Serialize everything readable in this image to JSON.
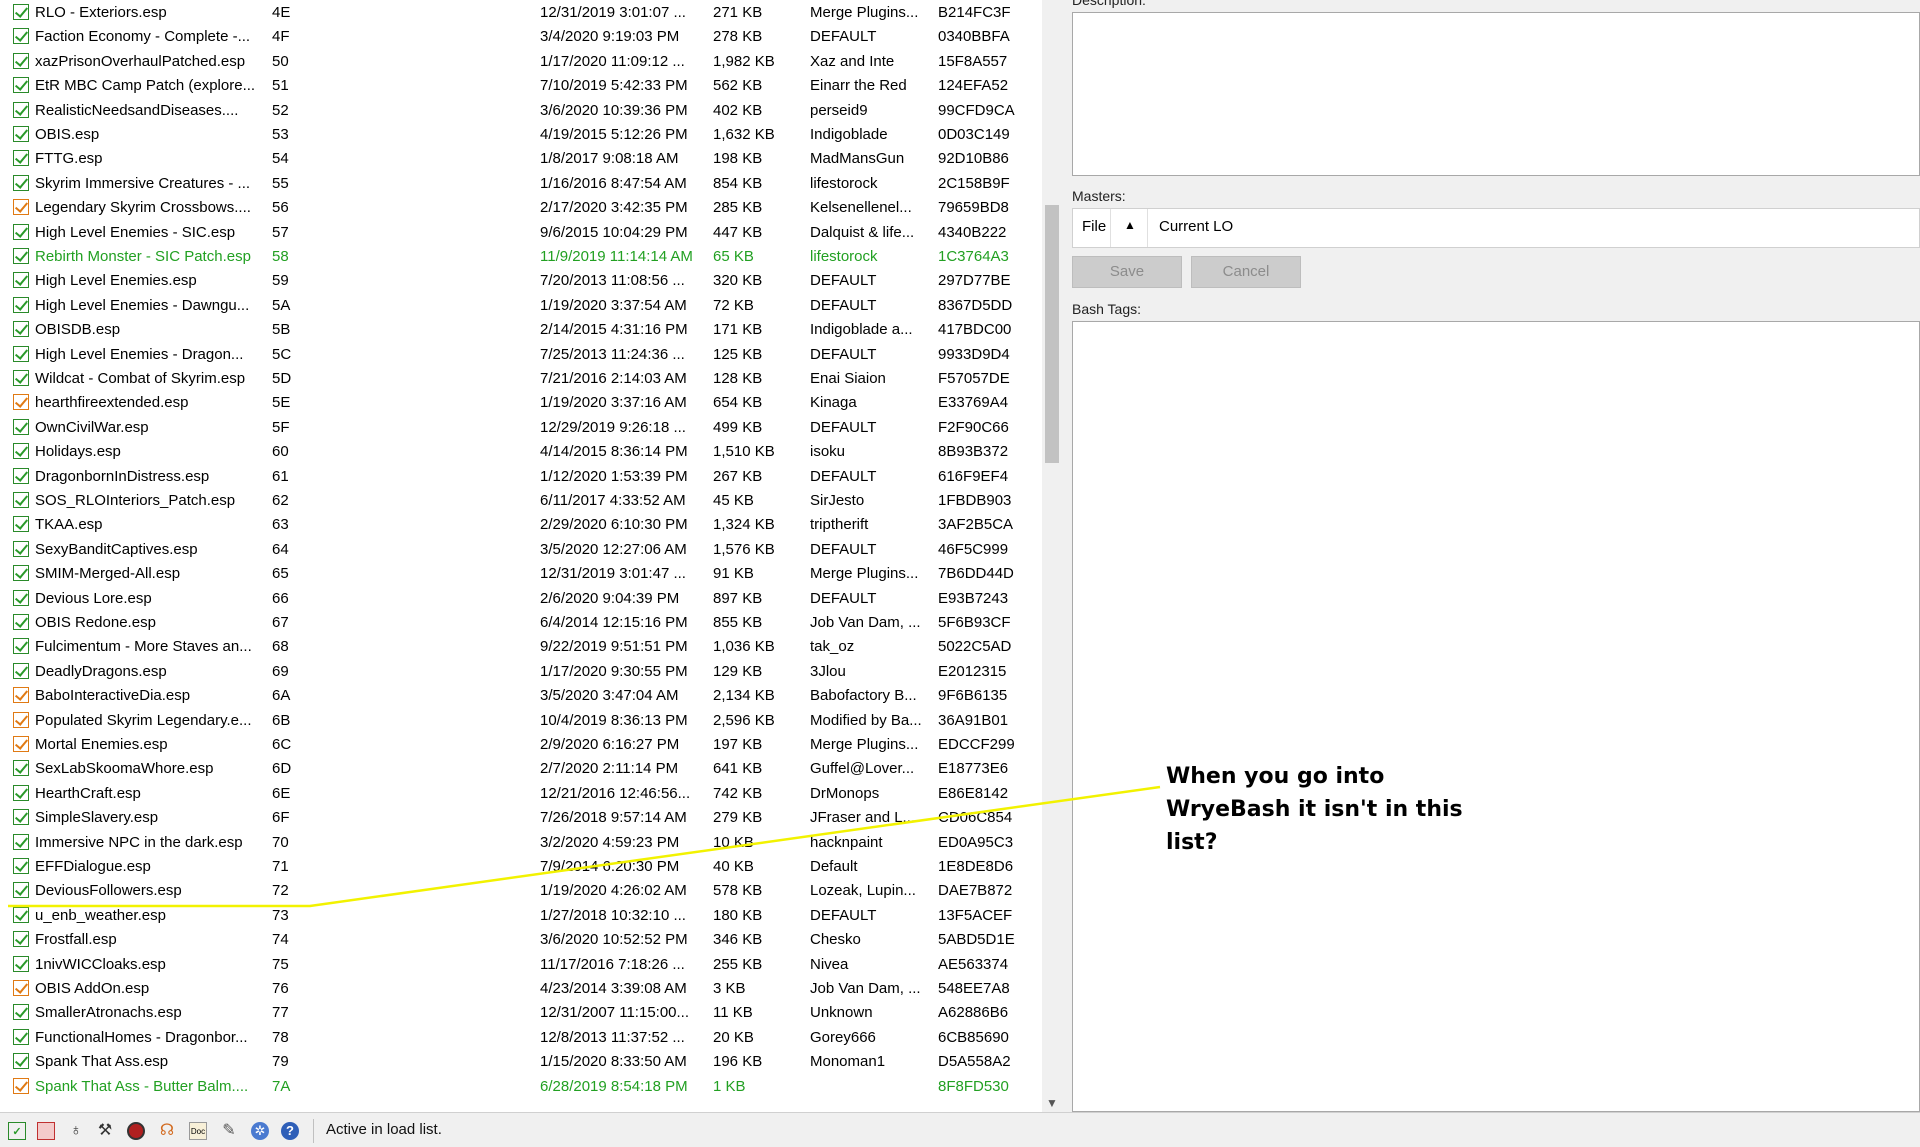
{
  "plugins": [
    {
      "name": "RLO - Exteriors.esp",
      "index": "4E",
      "date": "12/31/2019 3:01:07 ...",
      "size": "271 KB",
      "author": "Merge Plugins...",
      "crc": "B214FC3F",
      "check": "green",
      "highlight": false
    },
    {
      "name": "Faction Economy - Complete -...",
      "index": "4F",
      "date": "3/4/2020 9:19:03 PM",
      "size": "278 KB",
      "author": "DEFAULT",
      "crc": "0340BBFA",
      "check": "green",
      "highlight": false
    },
    {
      "name": "xazPrisonOverhaulPatched.esp",
      "index": "50",
      "date": "1/17/2020 11:09:12 ...",
      "size": "1,982 KB",
      "author": "Xaz and Inte",
      "crc": "15F8A557",
      "check": "green",
      "highlight": false
    },
    {
      "name": "EtR MBC Camp Patch (explore...",
      "index": "51",
      "date": "7/10/2019 5:42:33 PM",
      "size": "562 KB",
      "author": "Einarr the Red",
      "crc": "124EFA52",
      "check": "green",
      "highlight": false
    },
    {
      "name": "RealisticNeedsandDiseases....",
      "index": "52",
      "date": "3/6/2020 10:39:36 PM",
      "size": "402 KB",
      "author": "perseid9",
      "crc": "99CFD9CA",
      "check": "green",
      "highlight": false
    },
    {
      "name": "OBIS.esp",
      "index": "53",
      "date": "4/19/2015 5:12:26 PM",
      "size": "1,632 KB",
      "author": "Indigoblade",
      "crc": "0D03C149",
      "check": "green",
      "highlight": false
    },
    {
      "name": "FTTG.esp",
      "index": "54",
      "date": "1/8/2017 9:08:18 AM",
      "size": "198 KB",
      "author": "MadMansGun",
      "crc": "92D10B86",
      "check": "green",
      "highlight": false
    },
    {
      "name": "Skyrim Immersive Creatures - ...",
      "index": "55",
      "date": "1/16/2016 8:47:54 AM",
      "size": "854 KB",
      "author": "lifestorock",
      "crc": "2C158B9F",
      "check": "green",
      "highlight": false
    },
    {
      "name": "Legendary Skyrim Crossbows....",
      "index": "56",
      "date": "2/17/2020 3:42:35 PM",
      "size": "285 KB",
      "author": "Kelsenellenel...",
      "crc": "79659BD8",
      "check": "orange",
      "highlight": false
    },
    {
      "name": "High Level Enemies - SIC.esp",
      "index": "57",
      "date": "9/6/2015 10:04:29 PM",
      "size": "447 KB",
      "author": "Dalquist & life...",
      "crc": "4340B222",
      "check": "green",
      "highlight": false
    },
    {
      "name": "Rebirth Monster - SIC Patch.esp",
      "index": "58",
      "date": "11/9/2019 11:14:14 AM",
      "size": "65 KB",
      "author": "lifestorock",
      "crc": "1C3764A3",
      "check": "green",
      "highlight": true
    },
    {
      "name": "High Level Enemies.esp",
      "index": "59",
      "date": "7/20/2013 11:08:56 ...",
      "size": "320 KB",
      "author": "DEFAULT",
      "crc": "297D77BE",
      "check": "green",
      "highlight": false
    },
    {
      "name": "High Level Enemies - Dawngu...",
      "index": "5A",
      "date": "1/19/2020 3:37:54 AM",
      "size": "72 KB",
      "author": "DEFAULT",
      "crc": "8367D5DD",
      "check": "green",
      "highlight": false
    },
    {
      "name": "OBISDB.esp",
      "index": "5B",
      "date": "2/14/2015 4:31:16 PM",
      "size": "171 KB",
      "author": "Indigoblade a...",
      "crc": "417BDC00",
      "check": "green",
      "highlight": false
    },
    {
      "name": "High Level Enemies - Dragon...",
      "index": "5C",
      "date": "7/25/2013 11:24:36 ...",
      "size": "125 KB",
      "author": "DEFAULT",
      "crc": "9933D9D4",
      "check": "green",
      "highlight": false
    },
    {
      "name": "Wildcat - Combat of Skyrim.esp",
      "index": "5D",
      "date": "7/21/2016 2:14:03 AM",
      "size": "128 KB",
      "author": "Enai Siaion",
      "crc": "F57057DE",
      "check": "green",
      "highlight": false
    },
    {
      "name": "hearthfireextended.esp",
      "index": "5E",
      "date": "1/19/2020 3:37:16 AM",
      "size": "654 KB",
      "author": "Kinaga",
      "crc": "E33769A4",
      "check": "orange",
      "highlight": false
    },
    {
      "name": "OwnCivilWar.esp",
      "index": "5F",
      "date": "12/29/2019 9:26:18 ...",
      "size": "499 KB",
      "author": "DEFAULT",
      "crc": "F2F90C66",
      "check": "green",
      "highlight": false
    },
    {
      "name": "Holidays.esp",
      "index": "60",
      "date": "4/14/2015 8:36:14 PM",
      "size": "1,510 KB",
      "author": "isoku",
      "crc": "8B93B372",
      "check": "green",
      "highlight": false
    },
    {
      "name": "DragonbornInDistress.esp",
      "index": "61",
      "date": "1/12/2020 1:53:39 PM",
      "size": "267 KB",
      "author": "DEFAULT",
      "crc": "616F9EF4",
      "check": "green",
      "highlight": false
    },
    {
      "name": "SOS_RLOInteriors_Patch.esp",
      "index": "62",
      "date": "6/11/2017 4:33:52 AM",
      "size": "45 KB",
      "author": "SirJesto",
      "crc": "1FBDB903",
      "check": "green",
      "highlight": false
    },
    {
      "name": "TKAA.esp",
      "index": "63",
      "date": "2/29/2020 6:10:30 PM",
      "size": "1,324 KB",
      "author": "triptherift",
      "crc": "3AF2B5CA",
      "check": "green",
      "highlight": false
    },
    {
      "name": "SexyBanditCaptives.esp",
      "index": "64",
      "date": "3/5/2020 12:27:06 AM",
      "size": "1,576 KB",
      "author": "DEFAULT",
      "crc": "46F5C999",
      "check": "green",
      "highlight": false
    },
    {
      "name": "SMIM-Merged-All.esp",
      "index": "65",
      "date": "12/31/2019 3:01:47 ...",
      "size": "91 KB",
      "author": "Merge Plugins...",
      "crc": "7B6DD44D",
      "check": "green",
      "highlight": false
    },
    {
      "name": "Devious Lore.esp",
      "index": "66",
      "date": "2/6/2020 9:04:39 PM",
      "size": "897 KB",
      "author": "DEFAULT",
      "crc": "E93B7243",
      "check": "green",
      "highlight": false
    },
    {
      "name": "OBIS Redone.esp",
      "index": "67",
      "date": "6/4/2014 12:15:16 PM",
      "size": "855 KB",
      "author": "Job Van Dam, ...",
      "crc": "5F6B93CF",
      "check": "green",
      "highlight": false
    },
    {
      "name": "Fulcimentum - More Staves an...",
      "index": "68",
      "date": "9/22/2019 9:51:51 PM",
      "size": "1,036 KB",
      "author": "tak_oz",
      "crc": "5022C5AD",
      "check": "green",
      "highlight": false
    },
    {
      "name": "DeadlyDragons.esp",
      "index": "69",
      "date": "1/17/2020 9:30:55 PM",
      "size": "129 KB",
      "author": "3Jlou",
      "crc": "E2012315",
      "check": "green",
      "highlight": false
    },
    {
      "name": "BaboInteractiveDia.esp",
      "index": "6A",
      "date": "3/5/2020 3:47:04 AM",
      "size": "2,134 KB",
      "author": "Babofactory B...",
      "crc": "9F6B6135",
      "check": "orange",
      "highlight": false
    },
    {
      "name": "Populated Skyrim Legendary.e...",
      "index": "6B",
      "date": "10/4/2019 8:36:13 PM",
      "size": "2,596 KB",
      "author": "Modified by Ba...",
      "crc": "36A91B01",
      "check": "orange",
      "highlight": false
    },
    {
      "name": "Mortal Enemies.esp",
      "index": "6C",
      "date": "2/9/2020 6:16:27 PM",
      "size": "197 KB",
      "author": "Merge Plugins...",
      "crc": "EDCCF299",
      "check": "orange",
      "highlight": false
    },
    {
      "name": "SexLabSkoomaWhore.esp",
      "index": "6D",
      "date": "2/7/2020 2:11:14 PM",
      "size": "641 KB",
      "author": "Guffel@Lover...",
      "crc": "E18773E6",
      "check": "green",
      "highlight": false
    },
    {
      "name": "HearthCraft.esp",
      "index": "6E",
      "date": "12/21/2016 12:46:56...",
      "size": "742 KB",
      "author": "DrMonops",
      "crc": "E86E8142",
      "check": "green",
      "highlight": false
    },
    {
      "name": "SimpleSlavery.esp",
      "index": "6F",
      "date": "7/26/2018 9:57:14 AM",
      "size": "279 KB",
      "author": "JFraser and L...",
      "crc": "CD06C854",
      "check": "green",
      "highlight": false
    },
    {
      "name": "Immersive NPC in the dark.esp",
      "index": "70",
      "date": "3/2/2020 4:59:23 PM",
      "size": "10 KB",
      "author": "hacknpaint",
      "crc": "ED0A95C3",
      "check": "green",
      "highlight": false
    },
    {
      "name": "EFFDialogue.esp",
      "index": "71",
      "date": "7/9/2014 6:20:30 PM",
      "size": "40 KB",
      "author": "Default",
      "crc": "1E8DE8D6",
      "check": "green",
      "highlight": false
    },
    {
      "name": "DeviousFollowers.esp",
      "index": "72",
      "date": "1/19/2020 4:26:02 AM",
      "size": "578 KB",
      "author": "Lozeak, Lupin...",
      "crc": "DAE7B872",
      "check": "green",
      "highlight": false
    },
    {
      "name": "u_enb_weather.esp",
      "index": "73",
      "date": "1/27/2018 10:32:10 ...",
      "size": "180 KB",
      "author": "DEFAULT",
      "crc": "13F5ACEF",
      "check": "green",
      "highlight": false
    },
    {
      "name": "Frostfall.esp",
      "index": "74",
      "date": "3/6/2020 10:52:52 PM",
      "size": "346 KB",
      "author": "Chesko",
      "crc": "5ABD5D1E",
      "check": "green",
      "highlight": false
    },
    {
      "name": "1nivWICCloaks.esp",
      "index": "75",
      "date": "11/17/2016 7:18:26 ...",
      "size": "255 KB",
      "author": "Nivea",
      "crc": "AE563374",
      "check": "green",
      "highlight": false
    },
    {
      "name": "OBIS AddOn.esp",
      "index": "76",
      "date": "4/23/2014 3:39:08 AM",
      "size": "3 KB",
      "author": "Job Van Dam, ...",
      "crc": "548EE7A8",
      "check": "orange",
      "highlight": false
    },
    {
      "name": "SmallerAtronachs.esp",
      "index": "77",
      "date": "12/31/2007 11:15:00...",
      "size": "11 KB",
      "author": "Unknown",
      "crc": "A62886B6",
      "check": "green",
      "highlight": false
    },
    {
      "name": "FunctionalHomes - Dragonbor...",
      "index": "78",
      "date": "12/8/2013 11:37:52 ...",
      "size": "20 KB",
      "author": "Gorey666",
      "crc": "6CB85690",
      "check": "green",
      "highlight": false
    },
    {
      "name": "Spank That Ass.esp",
      "index": "79",
      "date": "1/15/2020 8:33:50 AM",
      "size": "196 KB",
      "author": "Monoman1",
      "crc": "D5A558A2",
      "check": "green",
      "highlight": false
    },
    {
      "name": "Spank That Ass - Butter Balm....",
      "index": "7A",
      "date": "6/28/2019 8:54:18 PM",
      "size": "1 KB",
      "author": "",
      "crc": "8F8FD530",
      "check": "orange",
      "highlight": true
    }
  ],
  "right_panel": {
    "description_label": "Description:",
    "masters_label": "Masters:",
    "masters_col_file": "File",
    "masters_col_current_lo": "Current LO",
    "save_label": "Save",
    "cancel_label": "Cancel",
    "bash_tags_label": "Bash Tags:"
  },
  "status": {
    "text": "Active in load list."
  },
  "annotation": {
    "text": "When you go into WryeBash it isn't in this list?",
    "line_color": "#f2f200"
  },
  "colors": {
    "check_green": "#2a9a2a",
    "check_orange": "#e07a14",
    "highlight_text": "#22a022"
  }
}
